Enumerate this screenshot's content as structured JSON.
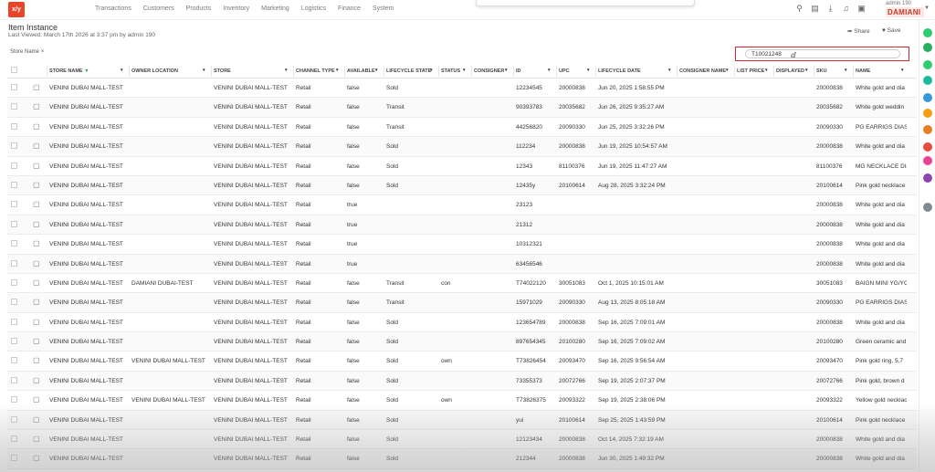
{
  "app": {
    "logo_text": "x/y",
    "user_label": "admin 190",
    "brand": "DAMIANI"
  },
  "nav": [
    "Transactions",
    "Customers",
    "Products",
    "Inventory",
    "Marketing",
    "Logistics",
    "Finance",
    "System"
  ],
  "page": {
    "title": "Item Instance",
    "subtitle": "Last Viewed: March 17th 2026 at 3:37 pm by admin 190",
    "share_label": "Share",
    "save_label": "Save"
  },
  "filter": {
    "chip": "Store Name",
    "chip_close": "×"
  },
  "search": {
    "value": "T10021248"
  },
  "columns": [
    "STORE NAME",
    "OWNER LOCATION",
    "STORE",
    "CHANNEL TYPE",
    "AVAILABLE",
    "LIFECYCLE STATE",
    "STATUS",
    "CONSIGNER",
    "ID",
    "UPC",
    "LIFECYCLE DATE",
    "CONSIGNER NAME",
    "LIST PRICE",
    "DISPLAYED",
    "SKU",
    "NAME"
  ],
  "rows": [
    [
      "VENINI DUBAI MALL-TEST",
      "",
      "VENINI DUBAI MALL-TEST",
      "Retail",
      "false",
      "Sold",
      "",
      "",
      "12234545",
      "20000838",
      "Jun 20, 2025 1:58:55 PM",
      "",
      "",
      "",
      "20000838",
      "White gold and dia"
    ],
    [
      "VENINI DUBAI MALL-TEST",
      "",
      "VENINI DUBAI MALL-TEST",
      "Retail",
      "false",
      "Transit",
      "",
      "",
      "90393783",
      "20035682",
      "Jun 26, 2025 9:35:27 AM",
      "",
      "",
      "",
      "20035682",
      "White gold weddin"
    ],
    [
      "VENINI DUBAI MALL-TEST",
      "",
      "VENINI DUBAI MALL-TEST",
      "Retail",
      "false",
      "Transit",
      "",
      "",
      "44256820",
      "20090330",
      "Jun 25, 2025 3:32:26 PM",
      "",
      "",
      "",
      "20090330",
      "PG EARRIGS DIAS."
    ],
    [
      "VENINI DUBAI MALL-TEST",
      "",
      "VENINI DUBAI MALL-TEST",
      "Retail",
      "false",
      "Sold",
      "",
      "",
      "112234",
      "20000838",
      "Jun 19, 2025 10:54:57 AM",
      "",
      "",
      "",
      "20000838",
      "White gold and dia"
    ],
    [
      "VENINI DUBAI MALL-TEST",
      "",
      "VENINI DUBAI MALL-TEST",
      "Retail",
      "false",
      "Sold",
      "",
      "",
      "12343",
      "81100376",
      "Jun 19, 2025 11:47:27 AM",
      "",
      "",
      "",
      "81100376",
      "MG NECKLACE DIA"
    ],
    [
      "VENINI DUBAI MALL-TEST",
      "",
      "VENINI DUBAI MALL-TEST",
      "Retail",
      "false",
      "Sold",
      "",
      "",
      "12435y",
      "20100614",
      "Aug 28, 2025 3:32:24 PM",
      "",
      "",
      "",
      "20100614",
      "Pink gold necklace"
    ],
    [
      "VENINI DUBAI MALL-TEST",
      "",
      "VENINI DUBAI MALL-TEST",
      "Retail",
      "true",
      "",
      "",
      "",
      "23123",
      "",
      "",
      "",
      "",
      "",
      "20000838",
      "White gold and dia"
    ],
    [
      "VENINI DUBAI MALL-TEST",
      "",
      "VENINI DUBAI MALL-TEST",
      "Retail",
      "true",
      "",
      "",
      "",
      "21312",
      "",
      "",
      "",
      "",
      "",
      "20000838",
      "White gold and dia"
    ],
    [
      "VENINI DUBAI MALL-TEST",
      "",
      "VENINI DUBAI MALL-TEST",
      "Retail",
      "true",
      "",
      "",
      "",
      "10312321",
      "",
      "",
      "",
      "",
      "",
      "20000838",
      "White gold and dia"
    ],
    [
      "VENINI DUBAI MALL-TEST",
      "",
      "VENINI DUBAI MALL-TEST",
      "Retail",
      "true",
      "",
      "",
      "",
      "63456546",
      "",
      "",
      "",
      "",
      "",
      "20000838",
      "White gold and dia"
    ],
    [
      "VENINI DUBAI MALL-TEST",
      "DAMIANI DUBAI-TEST",
      "VENINI DUBAI MALL-TEST",
      "Retail",
      "false",
      "Transit",
      "con",
      "",
      "T74022120",
      "30051083",
      "Oct 1, 2025 10:15:01 AM",
      "",
      "",
      "",
      "30051083",
      "BAIGN MINI YG/YG"
    ],
    [
      "VENINI DUBAI MALL-TEST",
      "",
      "VENINI DUBAI MALL-TEST",
      "Retail",
      "false",
      "Transit",
      "",
      "",
      "15971029",
      "20090330",
      "Aug 13, 2025 8:05:18 AM",
      "",
      "",
      "",
      "20090330",
      "PG EARRIGS DIAS."
    ],
    [
      "VENINI DUBAI MALL-TEST",
      "",
      "VENINI DUBAI MALL-TEST",
      "Retail",
      "false",
      "Sold",
      "",
      "",
      "123654789",
      "20000838",
      "Sep 16, 2025 7:09:01 AM",
      "",
      "",
      "",
      "20000838",
      "White gold and dia"
    ],
    [
      "VENINI DUBAI MALL-TEST",
      "",
      "VENINI DUBAI MALL-TEST",
      "Retail",
      "false",
      "Sold",
      "",
      "",
      "897654345",
      "20100280",
      "Sep 16, 2025 7:09:02 AM",
      "",
      "",
      "",
      "20100280",
      "Green ceramic and"
    ],
    [
      "VENINI DUBAI MALL-TEST",
      "VENINI DUBAI MALL-TEST",
      "VENINI DUBAI MALL-TEST",
      "Retail",
      "false",
      "Sold",
      "own",
      "",
      "T73826454",
      "20093470",
      "Sep 16, 2025 9:56:54 AM",
      "",
      "",
      "",
      "20093470",
      "Pink gold ring, 5,7"
    ],
    [
      "VENINI DUBAI MALL-TEST",
      "",
      "VENINI DUBAI MALL-TEST",
      "Retail",
      "false",
      "Sold",
      "",
      "",
      "73355373",
      "20072766",
      "Sep 19, 2025 2:07:37 PM",
      "",
      "",
      "",
      "20072766",
      "Pink gold, brown d"
    ],
    [
      "VENINI DUBAI MALL-TEST",
      "VENINI DUBAI MALL-TEST",
      "VENINI DUBAI MALL-TEST",
      "Retail",
      "false",
      "Sold",
      "own",
      "",
      "T73826375",
      "20093322",
      "Sep 19, 2025 2:38:06 PM",
      "",
      "",
      "",
      "20093322",
      "Yellow gold necklac"
    ],
    [
      "VENINI DUBAI MALL-TEST",
      "",
      "VENINI DUBAI MALL-TEST",
      "Retail",
      "false",
      "Sold",
      "",
      "",
      "yui",
      "20100614",
      "Sep 25, 2025 1:43:59 PM",
      "",
      "",
      "",
      "20100614",
      "Pink gold necklace"
    ],
    [
      "VENINI DUBAI MALL-TEST",
      "",
      "VENINI DUBAI MALL-TEST",
      "Retail",
      "false",
      "Sold",
      "",
      "",
      "12123434",
      "20000838",
      "Oct 14, 2025 7:32:19 AM",
      "",
      "",
      "",
      "20000838",
      "White gold and dia"
    ],
    [
      "VENINI DUBAI MALL-TEST",
      "",
      "VENINI DUBAI MALL-TEST",
      "Retail",
      "false",
      "Sold",
      "",
      "",
      "212344",
      "20000838",
      "Jun 30, 2025 1:49:32 PM",
      "",
      "",
      "",
      "20000838",
      "White gold and dia"
    ]
  ],
  "colors": {
    "accent": "#e8442a",
    "highlight_border": "#d0282e",
    "brand_bg": "#fde7e3"
  },
  "side_icons": [
    {
      "name": "chat-icon",
      "color": "#2ecc71"
    },
    {
      "name": "send-icon",
      "color": "#27ae60"
    },
    {
      "name": "refresh-icon",
      "color": "#2ecc71"
    },
    {
      "name": "ticket-icon",
      "color": "#1abc9c"
    },
    {
      "name": "grid-icon",
      "color": "#3498db"
    },
    {
      "name": "list-icon",
      "color": "#f39c12"
    },
    {
      "name": "cloud-icon",
      "color": "#e67e22"
    },
    {
      "name": "calendar-icon",
      "color": "#e74c3c"
    },
    {
      "name": "tag-icon",
      "color": "#e84393"
    },
    {
      "name": "code-icon",
      "color": "#8e44ad"
    },
    {
      "name": "settings-icon",
      "color": "#7f8c8d"
    }
  ]
}
